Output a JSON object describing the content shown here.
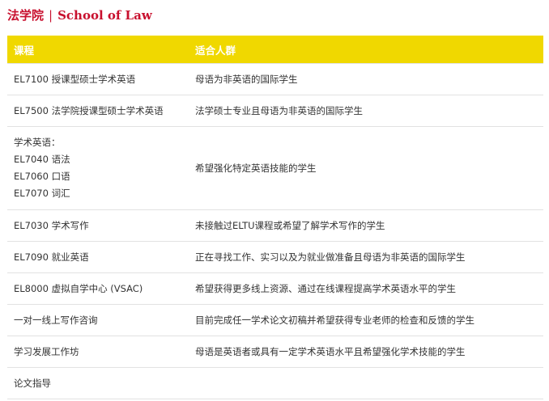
{
  "header": {
    "chinese": "法学院",
    "separator": "|",
    "english": "School of Law"
  },
  "table": {
    "columns": [
      "课程",
      "适合人群"
    ],
    "rows": [
      {
        "course": [
          "EL7100 授课型硕士学术英语"
        ],
        "audience": "母语为非英语的国际学生"
      },
      {
        "course": [
          "EL7500 法学院授课型硕士学术英语"
        ],
        "audience": "法学硕士专业且母语为非英语的国际学生"
      },
      {
        "course": [
          "学术英语：",
          "EL7040 语法",
          "EL7060 口语",
          "EL7070 词汇"
        ],
        "audience": "希望强化特定英语技能的学生"
      },
      {
        "course": [
          "EL7030 学术写作"
        ],
        "audience": "未接触过ELTU课程或希望了解学术写作的学生"
      },
      {
        "course": [
          "EL7090 就业英语"
        ],
        "audience": "正在寻找工作、实习以及为就业做准备且母语为非英语的国际学生"
      },
      {
        "course": [
          "EL8000 虚拟自学中心 (VSAC)"
        ],
        "audience": "希望获得更多线上资源、通过在线课程提高学术英语水平的学生"
      },
      {
        "course": [
          "一对一线上写作咨询"
        ],
        "audience": "目前完成任一学术论文初稿并希望获得专业老师的检查和反馈的学生"
      },
      {
        "course": [
          "学习发展工作坊"
        ],
        "audience": "母语是英语者或具有一定学术英语水平且希望强化学术技能的学生"
      },
      {
        "course": [
          "论文指导"
        ],
        "audience": ""
      }
    ]
  }
}
